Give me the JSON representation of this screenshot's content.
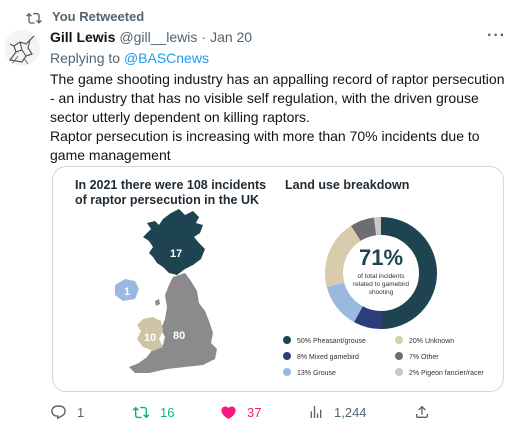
{
  "retweet_label": "You Retweeted",
  "tweet": {
    "author_name": "Gill Lewis",
    "author_handle": "@gill__lewis",
    "separator": "·",
    "date": "Jan 20",
    "more_label": "···",
    "reply_prefix": "Replying to",
    "reply_to": "@BASCnews",
    "paragraph1": "The game shooting industry has an appalling record of raptor persecution - an industry that has no visible self regulation, with the driven grouse sector utterly dependent on killing raptors.",
    "paragraph2": "Raptor persecution is increasing with more than 70% incidents due to game management"
  },
  "infographic": {
    "left_title_line1": "In 2021 there were 108 incidents",
    "left_title_line2": "of raptor persecution in the UK",
    "right_title": "Land use breakdown",
    "map_labels": {
      "scotland": "17",
      "northern_ireland": "1",
      "wales": "10",
      "england": "80"
    },
    "map_colors": {
      "scotland": "#1e4451",
      "northern_ireland": "#9ab8e0",
      "wales": "#cfc3a6",
      "england": "#8b8b8d"
    },
    "center_percent": "71%",
    "center_line1": "of total incidents",
    "center_line2": "related to gamebird",
    "center_line3": "shooting",
    "chart_data": {
      "type": "pie",
      "title": "Land use breakdown",
      "categories": [
        "Pheasant/grouse",
        "Mixed gamebird",
        "Grouse",
        "Unknown",
        "Other",
        "Pigeon fancier/racer"
      ],
      "values": [
        50,
        8,
        13,
        20,
        7,
        2
      ],
      "colors": [
        "#1e4451",
        "#2c3e7a",
        "#9ab8e0",
        "#d8ccac",
        "#6e6e70",
        "#c8c8c8"
      ]
    },
    "legend": [
      {
        "label": "50% Pheasant/grouse",
        "color": "#1e4451"
      },
      {
        "label": "20% Unknown",
        "color": "#d8ccac"
      },
      {
        "label": "8% Mixed gamebird",
        "color": "#2c3e7a"
      },
      {
        "label": "7% Other",
        "color": "#6e6e70"
      },
      {
        "label": "13% Grouse",
        "color": "#9ab8e0"
      },
      {
        "label": "2% Pigeon fancier/racer",
        "color": "#c8c8c8"
      }
    ]
  },
  "actions": {
    "replies": "1",
    "retweets": "16",
    "likes": "37",
    "views": "1,244"
  }
}
